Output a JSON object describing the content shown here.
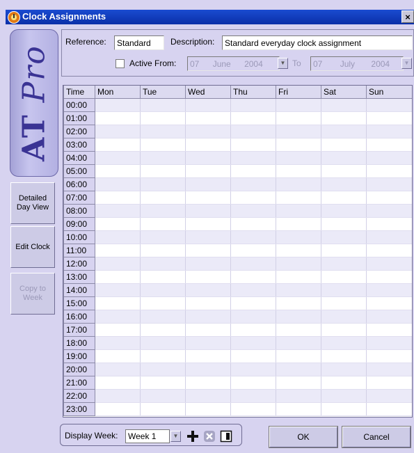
{
  "window": {
    "title": "Clock Assignments",
    "close_label": "×"
  },
  "brand": {
    "prefix": "AT",
    "suffix": "Pro"
  },
  "sidebar": {
    "detailed_day_view": "Detailed Day View",
    "edit_clock": "Edit Clock",
    "copy_to_week": "Copy to Week"
  },
  "header": {
    "reference_label": "Reference:",
    "reference_value": "Standard",
    "description_label": "Description:",
    "description_value": "Standard everyday clock assignment",
    "active_from_label": "Active From:",
    "active_from_checked": false,
    "from": {
      "day": "07",
      "month": "June",
      "year": "2004"
    },
    "to_label": "To",
    "to": {
      "day": "07",
      "month": "July",
      "year": "2004"
    }
  },
  "grid": {
    "columns": [
      "Time",
      "Mon",
      "Tue",
      "Wed",
      "Thu",
      "Fri",
      "Sat",
      "Sun"
    ],
    "times": [
      "00:00",
      "01:00",
      "02:00",
      "03:00",
      "04:00",
      "05:00",
      "06:00",
      "07:00",
      "08:00",
      "09:00",
      "10:00",
      "11:00",
      "12:00",
      "13:00",
      "14:00",
      "15:00",
      "16:00",
      "17:00",
      "18:00",
      "19:00",
      "20:00",
      "21:00",
      "22:00",
      "23:00"
    ]
  },
  "footer": {
    "display_week_label": "Display Week:",
    "week_value": "Week 1",
    "ok_label": "OK",
    "cancel_label": "Cancel"
  },
  "icons": {
    "add": "plus-icon",
    "delete": "delete-icon",
    "save": "save-icon"
  },
  "colors": {
    "titlebar": "#0a2fa8",
    "background": "#d7d3f0",
    "brand_text": "#3a3394"
  }
}
